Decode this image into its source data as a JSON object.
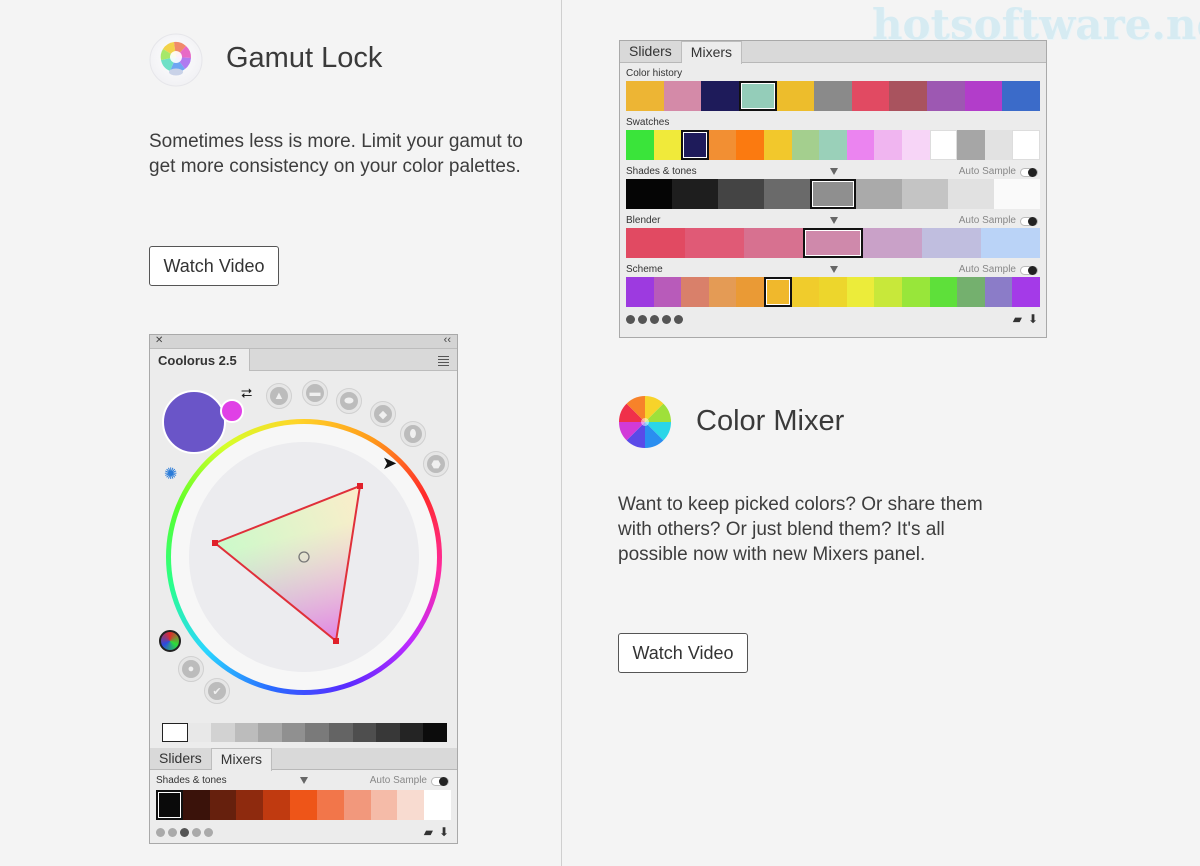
{
  "watermark": "hotsoftware.net",
  "gamut": {
    "title": "Gamut Lock",
    "description": "Sometimes less is more. Limit your gamut to get more consistency on your color palettes.",
    "button": "Watch Video",
    "icon": "gamut-lock-icon"
  },
  "mixer": {
    "title": "Color Mixer",
    "description": "Want to keep picked colors? Or share them with others? Or just blend them? It's all possible now with new Mixers panel.",
    "button": "Watch Video",
    "icon": "color-mixer-icon"
  },
  "coolorus": {
    "title": "Coolorus 2.5",
    "close": "✕",
    "collapse": "‹‹",
    "tabs": [
      "Sliders",
      "Mixers"
    ],
    "active_tab": "Mixers",
    "section": "Shades & tones",
    "auto_sample": "Auto Sample",
    "current_color": "#6a55c8",
    "previous_color": "#e040e6",
    "gray_ramp": [
      "#ffffff",
      "#e8e8e8",
      "#d2d2d2",
      "#bcbcbc",
      "#a6a6a6",
      "#909090",
      "#7a7a7a",
      "#646464",
      "#4e4e4e",
      "#383838",
      "#242424",
      "#0c0c0c"
    ],
    "shades": [
      "#0a0a0a",
      "#3a120a",
      "#66200d",
      "#8e2a0e",
      "#c03a10",
      "#ee5518",
      "#f2764a",
      "#f2987c",
      "#f5bba8",
      "#f8dbd0",
      "#ffffff"
    ],
    "shades_selected": 0
  },
  "mixers_panel": {
    "tabs": [
      "Sliders",
      "Mixers"
    ],
    "active_tab": "Mixers",
    "auto_sample": "Auto Sample",
    "rows": [
      {
        "label": "Color history",
        "has_controls": false,
        "selected": 3,
        "colors": [
          "#edb534",
          "#d48aa8",
          "#1e1b5a",
          "#94cdb9",
          "#edbd2c",
          "#8a8a8a",
          "#e14a62",
          "#a9535e",
          "#9d58b2",
          "#b23dca",
          "#3b6bc9"
        ]
      },
      {
        "label": "Swatches",
        "has_controls": false,
        "selected": 2,
        "colors": [
          "#3ae43a",
          "#f0ea3a",
          "#1e1b5a",
          "#f28f33",
          "#fb7a10",
          "#f2c82c",
          "#a4cf8e",
          "#9ad0b9",
          "#eb84f0",
          "#f0b5f0",
          "#f7d5f7",
          "#ffffff",
          "#a6a6a6",
          "#e2e2e2",
          "#ffffff"
        ]
      },
      {
        "label": "Shades & tones",
        "has_controls": true,
        "selected": 4,
        "colors": [
          "#050505",
          "#1e1e1e",
          "#444444",
          "#6a6a6a",
          "#8f8f8f",
          "#aaaaaa",
          "#c4c4c4",
          "#e1e1e1",
          "#fafafa"
        ]
      },
      {
        "label": "Blender",
        "has_controls": true,
        "selected": 3,
        "colors": [
          "#e14a62",
          "#e05a76",
          "#d77190",
          "#cf89ab",
          "#c9a1c8",
          "#c0bedf",
          "#bad3f7"
        ]
      },
      {
        "label": "Scheme",
        "has_controls": true,
        "selected": 5,
        "colors": [
          "#9d3ae0",
          "#b85bba",
          "#d9806a",
          "#e49b55",
          "#ea9a35",
          "#f0b82c",
          "#f0cc2c",
          "#edd62c",
          "#ecec3a",
          "#c8e83a",
          "#98e63a",
          "#5ee03a",
          "#74b06e",
          "#8b7cc8",
          "#a43ae8"
        ]
      }
    ]
  }
}
